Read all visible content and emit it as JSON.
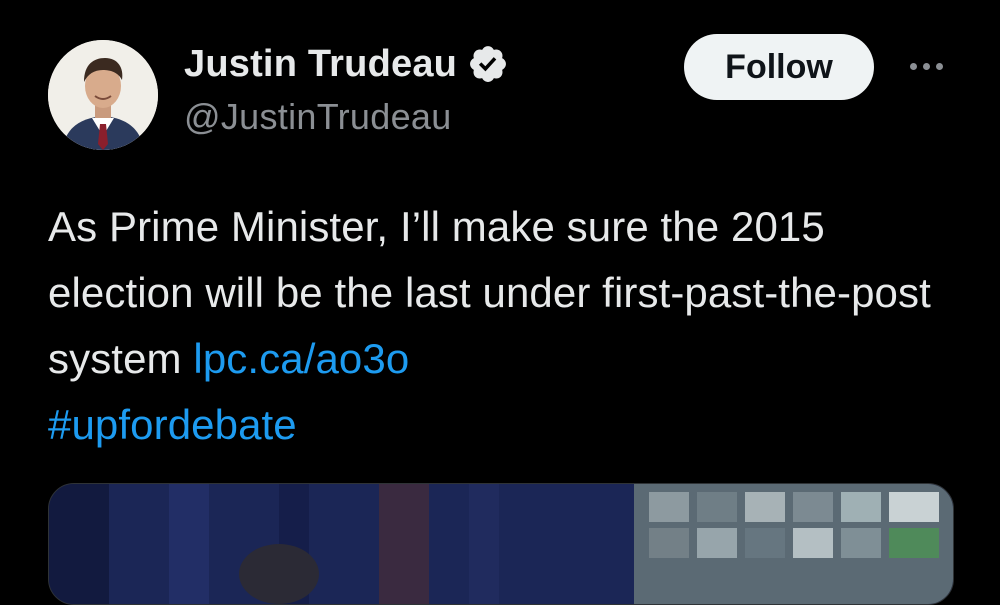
{
  "author": {
    "display_name": "Justin Trudeau",
    "handle": "@JustinTrudeau",
    "verified": true,
    "avatar_icon": "profile-photo"
  },
  "actions": {
    "follow_label": "Follow",
    "more_icon": "ellipsis-icon"
  },
  "tweet": {
    "text": "As Prime Minister, I’ll make sure the 2015 election will be the last under first-past-the-post system ",
    "link": "lpc.ca/ao3o",
    "hashtag": "#upfordebate"
  },
  "colors": {
    "background": "#000000",
    "text": "#e7e9ea",
    "secondary_text": "#8b8f94",
    "link": "#1d9bf0",
    "verified_badge": "#e7e9ea",
    "follow_bg": "#eff3f4"
  }
}
